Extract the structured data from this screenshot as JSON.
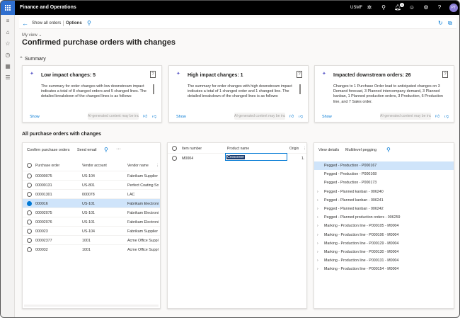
{
  "header": {
    "app_name": "Finance and Operations",
    "company": "USMF",
    "notif_count": "1",
    "avatar_initials": "PT"
  },
  "actionbar": {
    "show_all": "Show all orders",
    "options": "Options"
  },
  "page": {
    "my_view": "My view",
    "title": "Confirmed purchase orders with changes",
    "summary_heading": "Summary",
    "all_po_heading": "All purchase orders with changes"
  },
  "cards": [
    {
      "title": "Low impact changes: 5",
      "body": "The summary for order changes with low downstream impact indicates a total of 8 changed orders and 5 changed lines. The detailed breakdown of the changed lines is as follows:",
      "show": "Show",
      "ai_tag": "AI-generated content may be incorrect"
    },
    {
      "title": "High impact changes: 1",
      "body": "The summary for order changes with high downstream impact indicates a total of 1 changed order and 1 changed line. The detailed breakdown of the changed lines is as follows:",
      "show": "Show",
      "ai_tag": "AI-generated content may be incorrect"
    },
    {
      "title": "Impacted downstream orders: 26",
      "body": "Changes to 1 Purchase Order lead to anticipated changes on 3 Demand forecast, 3 Planned intercompany demand, 3 Planned kanban, 1 Planned production orders, 3 Production, 6 Production line, and 7 Sales order.",
      "show": "Show",
      "ai_tag": "AI-generated content may be incorrect"
    }
  ],
  "po_panel": {
    "toolbar": {
      "confirm": "Confirm purchase orders",
      "send_email": "Send email",
      "more": "···"
    },
    "columns": [
      "Purchase order",
      "Vendor account",
      "Vendor name"
    ],
    "rows": [
      [
        "00000075",
        "US-104",
        "Fabrikam Supplier"
      ],
      [
        "00000131",
        "US-801",
        "Perfect Coating Sol"
      ],
      [
        "00001301",
        "000078",
        "LAC"
      ],
      [
        "000016",
        "US-101",
        "Fabrikam Electronic"
      ],
      [
        "00002075",
        "US-101",
        "Fabrikam Electronic"
      ],
      [
        "00002076",
        "US-101",
        "Fabrikam Electronic"
      ],
      [
        "000023",
        "US-104",
        "Fabrikam Supplier"
      ],
      [
        "00002377",
        "1001",
        "Acme Office Supplie"
      ],
      [
        "000032",
        "1001",
        "Acme Office Supplie"
      ]
    ],
    "selected_index": 3
  },
  "line_panel": {
    "columns": [
      "Item number",
      "Product name",
      "Origin"
    ],
    "rows": [
      {
        "item": "M0004",
        "product": "Crossover",
        "origin": "1."
      }
    ]
  },
  "peg_panel": {
    "toolbar": {
      "view_details": "View details",
      "multilevel": "Multilevel pegging"
    },
    "items": [
      {
        "label": "Pegged - Production - P000167",
        "expand": false
      },
      {
        "label": "Pegged - Production - P000168",
        "expand": false
      },
      {
        "label": "Pegged - Production - P000173",
        "expand": false
      },
      {
        "label": "Pegged - Planned kanban - 006240",
        "expand": true
      },
      {
        "label": "Pegged - Planned kanban - 006241",
        "expand": true
      },
      {
        "label": "Pegged - Planned kanban - 006242",
        "expand": true
      },
      {
        "label": "Pegged - Planned production orders - 006259",
        "expand": true
      },
      {
        "label": "Marking - Production line - P000105 - M0004",
        "expand": true
      },
      {
        "label": "Marking - Production line - P000106 - M0004",
        "expand": true
      },
      {
        "label": "Marking - Production line - P000129 - M0004",
        "expand": true
      },
      {
        "label": "Marking - Production line - P000130 - M0004",
        "expand": true
      },
      {
        "label": "Marking - Production line - P000131 - M0004",
        "expand": true
      },
      {
        "label": "Marking - Production line - P000154 - M0004",
        "expand": true
      }
    ]
  }
}
